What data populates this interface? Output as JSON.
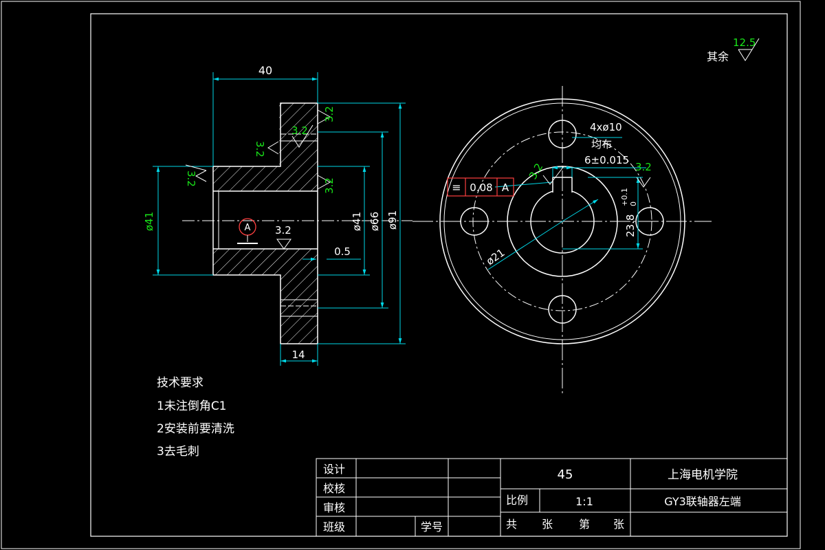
{
  "colors": {
    "background": "#000000",
    "outline": "#ffffff",
    "dimension": "#00d8e8",
    "dimension_text": "#19e619",
    "tolerance_frame": "#ff4040"
  },
  "roughness_note": {
    "label": "其余",
    "value": "12.5"
  },
  "section_view": {
    "dims": {
      "width_40": "40",
      "width_14": "14",
      "offset_05": "0.5",
      "dia_41_left": "ø41",
      "dia_41_right": "ø41",
      "dia_66": "ø66",
      "dia_91": "ø91"
    },
    "roughness": [
      "3.2",
      "3.2",
      "3.2",
      "3.2",
      "3.2",
      "3.2"
    ],
    "datum": "A"
  },
  "end_view": {
    "holes": "4xø10",
    "holes_note": "均布",
    "keyway": "6±0.015",
    "roughness_a": "3.2",
    "roughness_b": "3.2",
    "pcd": "ø21",
    "depth": "23.8",
    "depth_tol_upper": "+0.1",
    "depth_tol_lower": "0",
    "tolerance": {
      "symbol": "≡",
      "value": "0.08",
      "datum": "A"
    }
  },
  "tech_requirements": {
    "title": "技术要求",
    "items": [
      "1未注倒角C1",
      "2安装前要清洗",
      "3去毛刺"
    ]
  },
  "title_block": {
    "labels": [
      "设计",
      "校核",
      "审核",
      "班级"
    ],
    "student_no": "学号",
    "material": "45",
    "school": "上海电机学院",
    "scale_label": "比例",
    "scale_value": "1:1",
    "part_name": "GY3联轴器左端",
    "sheet": [
      "共",
      "张",
      "第",
      "张"
    ]
  }
}
